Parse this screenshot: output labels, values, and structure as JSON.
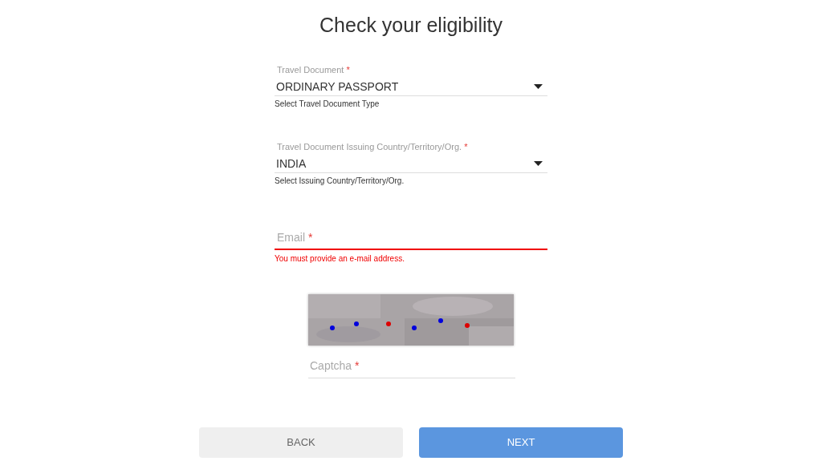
{
  "title": "Check your eligibility",
  "fields": [
    {
      "kind": "select",
      "label": "Travel Document",
      "required_mark": "*",
      "value": "ORDINARY PASSPORT",
      "hint": "Select Travel Document Type"
    },
    {
      "kind": "select",
      "label": "Travel Document Issuing Country/Territory/Org.",
      "required_mark": "*",
      "value": "INDIA",
      "hint": "Select Issuing Country/Territory/Org."
    },
    {
      "kind": "email",
      "label": "Email",
      "required_mark": "*",
      "error": "You must provide an e-mail address."
    }
  ],
  "captcha": {
    "label": "Captcha",
    "required_mark": "*"
  },
  "buttons": [
    {
      "label": "BACK",
      "kind": "secondary"
    },
    {
      "label": "NEXT",
      "kind": "primary"
    }
  ]
}
